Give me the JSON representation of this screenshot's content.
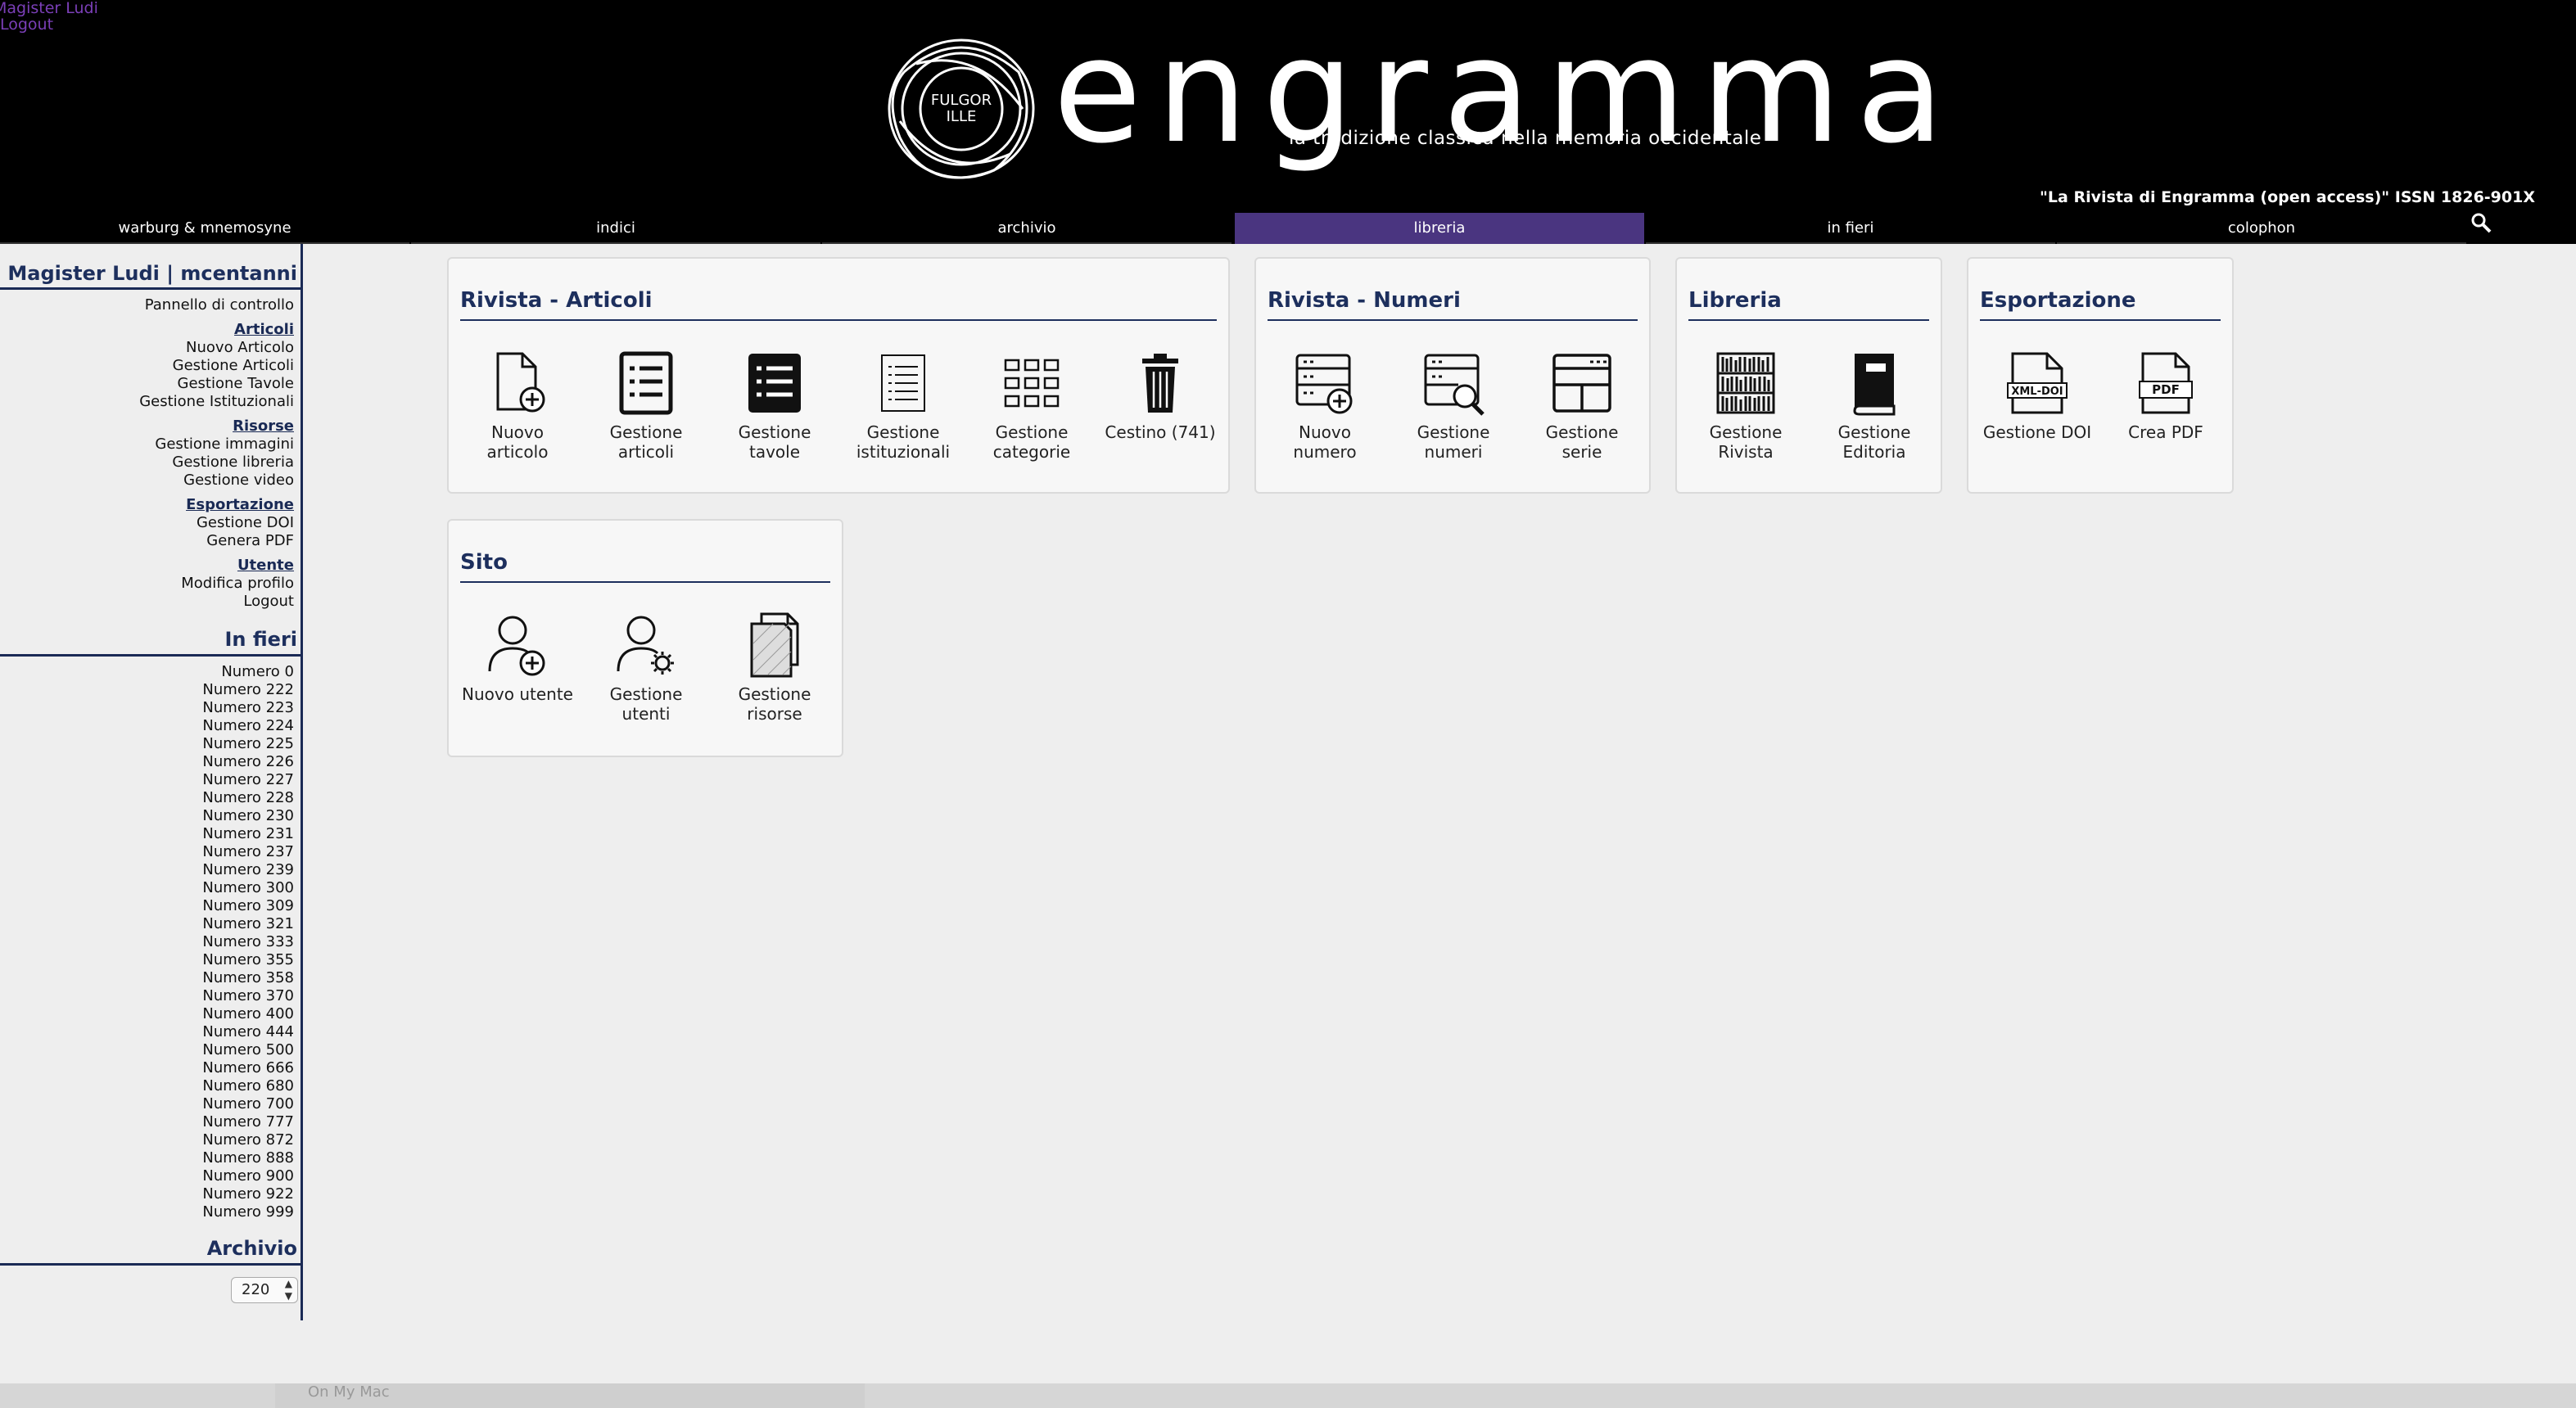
{
  "user_links": {
    "profile": "Magister Ludi",
    "logout": "Logout"
  },
  "logo": {
    "word": "engramma",
    "tagline": "la tradizione classica nella memoria occidentale",
    "emblem_text": "FULGOR ILLE"
  },
  "issn": "\"La Rivista di Engramma (open access)\" ISSN 1826-901X",
  "nav": {
    "items": [
      {
        "label": "warburg & mnemosyne"
      },
      {
        "label": "indici"
      },
      {
        "label": "archivio"
      },
      {
        "label": "libreria"
      },
      {
        "label": "in fieri"
      },
      {
        "label": "colophon"
      }
    ],
    "active": "libreria",
    "search_icon": "search-icon"
  },
  "sidebar": {
    "user_head": "Magister Ludi | mcentanni",
    "control_panel": "Pannello di controllo",
    "sections": {
      "articoli": {
        "title": "Articoli",
        "items": [
          "Nuovo Articolo",
          "Gestione Articoli",
          "Gestione Tavole",
          "Gestione Istituzionali"
        ]
      },
      "risorse": {
        "title": "Risorse",
        "items": [
          "Gestione immagini",
          "Gestione libreria",
          "Gestione video"
        ]
      },
      "esportazione": {
        "title": "Esportazione",
        "items": [
          "Gestione DOI",
          "Genera PDF"
        ]
      },
      "utente": {
        "title": "Utente",
        "items": [
          "Modifica profilo",
          "Logout"
        ]
      }
    },
    "in_fieri_head": "In fieri",
    "numeri": [
      "Numero 0",
      "Numero 222",
      "Numero 223",
      "Numero 224",
      "Numero 225",
      "Numero 226",
      "Numero 227",
      "Numero 228",
      "Numero 230",
      "Numero 231",
      "Numero 237",
      "Numero 239",
      "Numero 300",
      "Numero 309",
      "Numero 321",
      "Numero 333",
      "Numero 355",
      "Numero 358",
      "Numero 370",
      "Numero 400",
      "Numero 444",
      "Numero 500",
      "Numero 666",
      "Numero 680",
      "Numero 700",
      "Numero 777",
      "Numero 872",
      "Numero 888",
      "Numero 900",
      "Numero 922",
      "Numero 999"
    ],
    "archivio_head": "Archivio",
    "archivio_select": "220"
  },
  "cards": {
    "articoli": {
      "title": "Rivista - Articoli",
      "tiles": [
        {
          "label": "Nuovo articolo",
          "icon": "new-document-icon"
        },
        {
          "label": "Gestione articoli",
          "icon": "list-document-icon"
        },
        {
          "label": "Gestione tavole",
          "icon": "filled-list-icon"
        },
        {
          "label": "Gestione istituzionali",
          "icon": "thin-list-icon"
        },
        {
          "label": "Gestione categorie",
          "icon": "grid-icon"
        },
        {
          "label": "Cestino (741)",
          "icon": "trash-icon"
        }
      ]
    },
    "numeri": {
      "title": "Rivista - Numeri",
      "tiles": [
        {
          "label": "Nuovo numero",
          "icon": "new-issue-icon"
        },
        {
          "label": "Gestione numeri",
          "icon": "search-issue-icon"
        },
        {
          "label": "Gestione serie",
          "icon": "layout-icon"
        }
      ]
    },
    "libreria": {
      "title": "Libreria",
      "tiles": [
        {
          "label": "Gestione Rivista",
          "icon": "bookshelf-icon"
        },
        {
          "label": "Gestione Editoria",
          "icon": "book-icon"
        }
      ]
    },
    "esportazione": {
      "title": "Esportazione",
      "tiles": [
        {
          "label": "Gestione DOI",
          "icon": "xml-doi-icon",
          "badge": "XML-DOI"
        },
        {
          "label": "Crea PDF",
          "icon": "pdf-icon",
          "badge": "PDF"
        }
      ]
    },
    "sito": {
      "title": "Sito",
      "tiles": [
        {
          "label": "Nuovo utente",
          "icon": "add-user-icon"
        },
        {
          "label": "Gestione utenti",
          "icon": "user-settings-icon"
        },
        {
          "label": "Gestione risorse",
          "icon": "resources-icon"
        }
      ]
    }
  },
  "bottom_ghost": "On My Mac",
  "colors": {
    "nav_active": "#4a3580",
    "heading": "#1d2f5d",
    "header_bg": "#000000",
    "user_link": "#7b3fb8"
  }
}
